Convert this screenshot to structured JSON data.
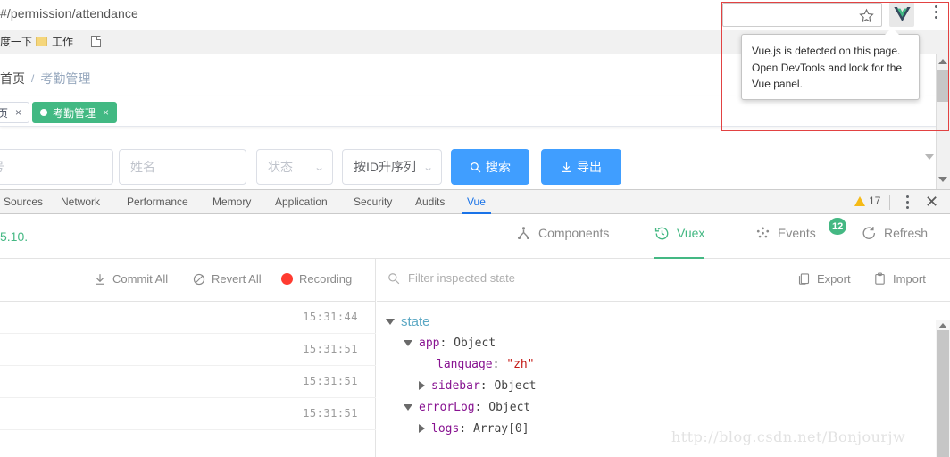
{
  "browser": {
    "url": "#/permission/attendance",
    "omnibox_placeholder": "",
    "star_icon": "star-icon",
    "vue_extension_icon": "vue-logo-icon",
    "menu_icon": "kebab-menu-icon",
    "bookmarks": [
      {
        "label": "度一下",
        "icon": "none"
      },
      {
        "label": "工作",
        "icon": "folder-icon"
      },
      {
        "label": "",
        "icon": "document-icon"
      }
    ],
    "vue_popup": {
      "line1": "Vue.js is detected on this page.",
      "line2": "Open DevTools and look for the",
      "line3": "Vue panel."
    }
  },
  "page": {
    "breadcrumb": {
      "home": "首页",
      "separator": "/",
      "current": "考勤管理"
    },
    "tabs": [
      {
        "label": "页",
        "close": "×",
        "active": false
      },
      {
        "label": "考勤管理",
        "close": "×",
        "active": true
      }
    ],
    "filters": {
      "id_placeholder": "工号",
      "name_placeholder": "姓名",
      "status_placeholder": "状态",
      "sort_value": "按ID升序列",
      "search_label": "搜索",
      "search_icon": "search-icon",
      "export_label": "导出",
      "export_icon": "download-icon"
    }
  },
  "devtools": {
    "tabs": [
      "Sources",
      "Network",
      "Performance",
      "Memory",
      "Application",
      "Security",
      "Audits",
      "Vue"
    ],
    "selected_tab": "Vue",
    "warning_icon": "warning-triangle-icon",
    "warning_count": "17",
    "menu_icon": "kebab-menu-icon",
    "close_icon": "close-icon"
  },
  "vue_panel": {
    "version": "5.10.",
    "tabs": [
      {
        "label": "Components",
        "icon": "component-tree-icon",
        "active": false,
        "badge": null
      },
      {
        "label": "Vuex",
        "icon": "history-clock-icon",
        "active": true,
        "badge": null
      },
      {
        "label": "Events",
        "icon": "events-dots-icon",
        "active": false,
        "badge": "12"
      },
      {
        "label": "Refresh",
        "icon": "refresh-icon",
        "active": false,
        "badge": null
      }
    ],
    "accent_color": "#44b883"
  },
  "vuex": {
    "toolbar_left": [
      {
        "label": "Commit All",
        "icon": "download-icon"
      },
      {
        "label": "Revert All",
        "icon": "no-entry-icon"
      },
      {
        "label": "Recording",
        "icon": "record-dot-icon"
      }
    ],
    "filter_placeholder": "Filter inspected state",
    "filter_icon": "search-icon",
    "toolbar_right": [
      {
        "label": "Export",
        "icon": "export-icon"
      },
      {
        "label": "Import",
        "icon": "import-clipboard-icon"
      }
    ],
    "history": [
      {
        "time": "15:31:44"
      },
      {
        "time": "15:31:51"
      },
      {
        "time": "15:31:51"
      },
      {
        "time": "15:31:51"
      }
    ],
    "state_tree": {
      "root": "state",
      "nodes": [
        {
          "indent": 1,
          "arrow": "down",
          "key": "app",
          "value": "Object",
          "type": "obj"
        },
        {
          "indent": 2,
          "arrow": "none",
          "key": "language",
          "value": "\"zh\"",
          "type": "str"
        },
        {
          "indent": 2,
          "arrow": "right",
          "key": "sidebar",
          "value": "Object",
          "type": "obj"
        },
        {
          "indent": 1,
          "arrow": "down",
          "key": "errorLog",
          "value": "Object",
          "type": "obj"
        },
        {
          "indent": 2,
          "arrow": "right",
          "key": "logs",
          "value": "Array[0]",
          "type": "obj"
        }
      ]
    }
  },
  "watermark": "http://blog.csdn.net/Bonjourjw"
}
